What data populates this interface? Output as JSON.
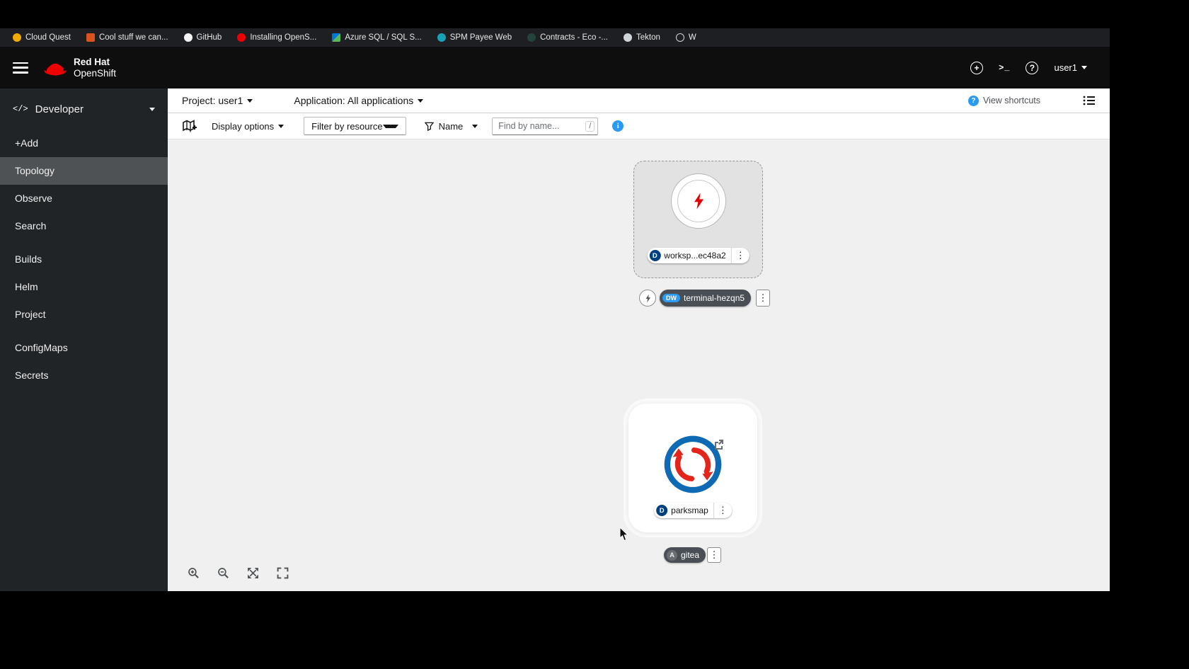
{
  "bookmarks": {
    "items": [
      {
        "label": "Cloud Quest",
        "icon": "cloud-quest-icon"
      },
      {
        "label": "Cool stuff we can...",
        "icon": "doc-icon"
      },
      {
        "label": "GitHub",
        "icon": "github-icon"
      },
      {
        "label": "Installing OpenS...",
        "icon": "openshift-icon"
      },
      {
        "label": "Azure SQL / SQL S...",
        "icon": "azure-icon"
      },
      {
        "label": "SPM Payee Web",
        "icon": "feather-icon"
      },
      {
        "label": "Contracts - Eco -...",
        "icon": "contracts-icon"
      },
      {
        "label": "Tekton",
        "icon": "tekton-icon"
      },
      {
        "label": "W",
        "icon": "globe-icon"
      }
    ]
  },
  "masthead": {
    "brand_top": "Red Hat",
    "brand_bottom": "OpenShift",
    "username": "user1"
  },
  "sidebar": {
    "perspective": "Developer",
    "items": [
      {
        "label": "+Add"
      },
      {
        "label": "Topology"
      },
      {
        "label": "Observe"
      },
      {
        "label": "Search"
      },
      {
        "label": "Builds"
      },
      {
        "label": "Helm"
      },
      {
        "label": "Project"
      },
      {
        "label": "ConfigMaps"
      },
      {
        "label": "Secrets"
      }
    ]
  },
  "context_bar": {
    "project": "Project: user1",
    "application": "Application: All applications",
    "view_shortcuts": "View shortcuts"
  },
  "toolbar": {
    "display_options": "Display options",
    "filter_by_resource": "Filter by resource",
    "name_filter": "Name",
    "find_placeholder": "Find by name...",
    "shortcut_hint": "/"
  },
  "topology": {
    "workspace": {
      "badge": "D",
      "label": "worksp...ec48a2"
    },
    "terminal": {
      "badge": "DW",
      "label": "terminal-hezqn5"
    },
    "parksmap": {
      "badge": "D",
      "label": "parksmap"
    },
    "gitea": {
      "badge": "A",
      "label": "gitea"
    }
  },
  "colors": {
    "accent_blue": "#2b9af3",
    "brand_red": "#ee0000",
    "badge_navy": "#004080",
    "canvas_bg": "#f0f0f0"
  }
}
